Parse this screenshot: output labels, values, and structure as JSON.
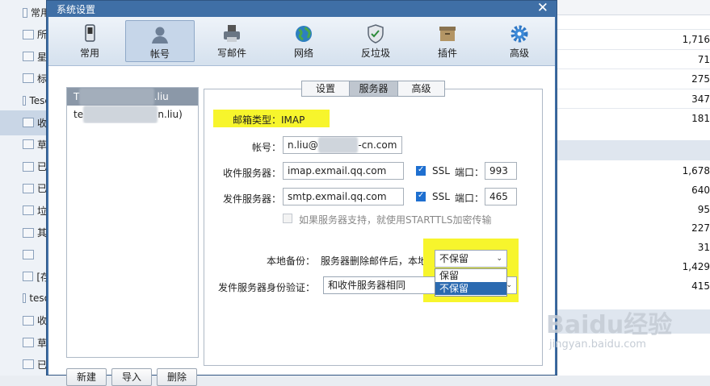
{
  "background": {
    "sidebar": [
      {
        "text": "常用",
        "sel": false
      },
      {
        "text": "所",
        "sel": false
      },
      {
        "text": "星",
        "sel": false
      },
      {
        "text": "标",
        "sel": false
      },
      {
        "text": "Tesc",
        "sel": false
      },
      {
        "text": "收",
        "sel": true
      },
      {
        "text": "草",
        "sel": false
      },
      {
        "text": "已",
        "sel": false
      },
      {
        "text": "已",
        "sel": false
      },
      {
        "text": "垃",
        "sel": false
      },
      {
        "text": "其",
        "sel": false
      },
      {
        "text": "",
        "sel": false
      },
      {
        "text": "[存",
        "sel": false
      },
      {
        "text": "teso",
        "sel": false
      },
      {
        "text": "收",
        "sel": false
      },
      {
        "text": "草",
        "sel": false
      },
      {
        "text": "已",
        "sel": false
      }
    ],
    "counts_top": [
      "1,716",
      "71",
      "275",
      "347",
      "181"
    ],
    "counts_bottom": [
      "1,678",
      "640",
      "95",
      "227",
      "31",
      "1,429",
      "415"
    ]
  },
  "dialog": {
    "title": "系统设置",
    "close": "✕",
    "toolbar": [
      "常用",
      "帐号",
      "写邮件",
      "网络",
      "反垃圾",
      "插件",
      "高级"
    ],
    "active_toolbar": "帐号",
    "accounts": [
      {
        "prefix": "T",
        "suffix": ".liu",
        "sel": true
      },
      {
        "prefix": "te",
        "suffix": "n.liu)",
        "sel": false
      }
    ],
    "account_buttons": [
      "新建",
      "导入",
      "删除"
    ],
    "tabs": [
      "设置",
      "服务器",
      "高级"
    ],
    "active_tab": "服务器",
    "mailbox_type": "邮箱类型：IMAP",
    "form": {
      "account_label": "帐号：",
      "account_prefix": "n.liu@",
      "account_suffix": "-cn.com",
      "incoming_label": "收件服务器：",
      "incoming_value": "imap.exmail.qq.com",
      "outgoing_label": "发件服务器：",
      "outgoing_value": "smtp.exmail.qq.com",
      "ssl_label": "SSL",
      "port_label": "端口：",
      "incoming_port": "993",
      "outgoing_port": "465",
      "starttls_text": "如果服务器支持，就使用STARTTLS加密传输",
      "backup_label": "本地备份：",
      "backup_desc": "服务器删除邮件后，本地",
      "backup_value": "不保留",
      "backup_options": [
        "保留",
        "不保留"
      ],
      "auth_label": "发件服务器身份验证：",
      "auth_value": "和收件服务器相同"
    }
  },
  "watermark": {
    "line1": "Baidu经验",
    "line2": "jingyan.baidu.com"
  },
  "colors": {
    "dialog_frame": "#3f6fa6",
    "highlight": "#f7f52c",
    "selected_option": "#2b6ab0"
  }
}
